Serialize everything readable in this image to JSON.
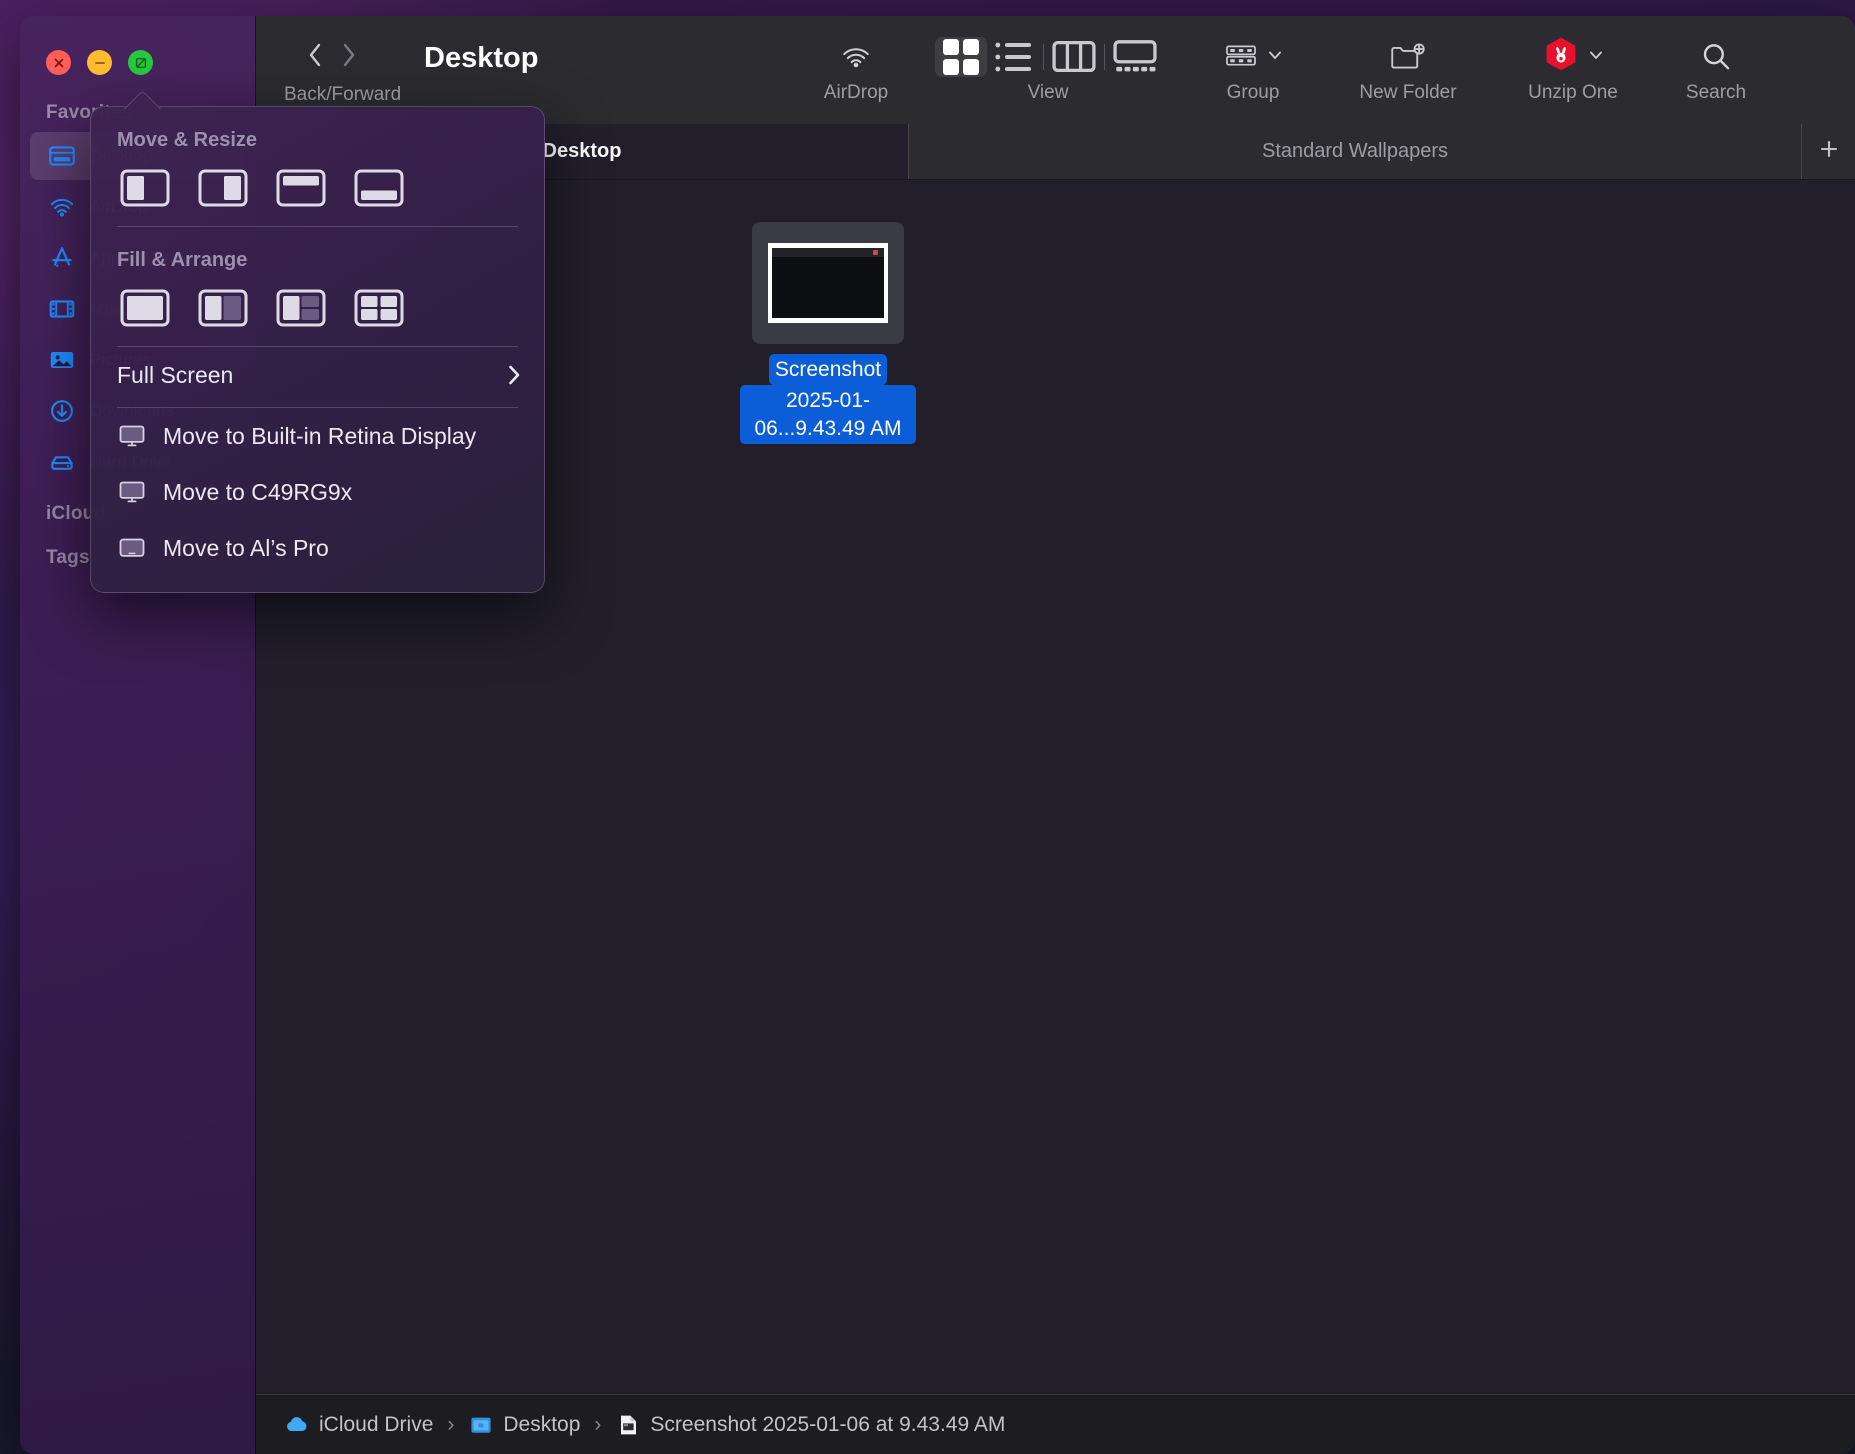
{
  "window": {
    "title": "Desktop",
    "traffic_lights": [
      {
        "name": "close",
        "color": "#ff5f57"
      },
      {
        "name": "minimize",
        "color": "#febc2e"
      },
      {
        "name": "zoom",
        "color": "#28c840"
      }
    ]
  },
  "sidebar": {
    "sections": [
      {
        "label": "Favorites"
      },
      {
        "label": "iCloud"
      },
      {
        "label": "Tags"
      }
    ],
    "favorites": [
      {
        "label": "Desktop",
        "icon": "desktop-icon",
        "selected": true
      },
      {
        "label": "AirDrop",
        "icon": "airdrop-icon",
        "selected": false
      },
      {
        "label": "Applications",
        "icon": "applications-icon",
        "selected": false
      },
      {
        "label": "Movies",
        "icon": "movies-icon",
        "selected": false
      },
      {
        "label": "Pictures",
        "icon": "pictures-icon",
        "selected": false
      },
      {
        "label": "Downloads",
        "icon": "downloads-icon",
        "selected": false
      },
      {
        "label": "Hard Drive",
        "icon": "harddrive-icon",
        "selected": false
      }
    ],
    "accent_color": "#1f8cff"
  },
  "toolbar": {
    "back_forward_label": "Back/Forward",
    "folder_title": "Desktop",
    "items": [
      {
        "key": "airdrop",
        "label": "AirDrop",
        "icon": "airdrop-icon"
      },
      {
        "key": "view",
        "label": "View",
        "icon": "view-segmented-icon"
      },
      {
        "key": "group",
        "label": "Group",
        "icon": "group-icon"
      },
      {
        "key": "new_folder",
        "label": "New Folder",
        "icon": "new-folder-icon"
      },
      {
        "key": "unzip_one",
        "label": "Unzip One",
        "icon": "unzip-one-icon"
      },
      {
        "key": "search",
        "label": "Search",
        "icon": "search-icon"
      }
    ],
    "view_modes": [
      {
        "key": "icon",
        "icon": "icon-view-icon",
        "active": true
      },
      {
        "key": "list",
        "icon": "list-view-icon",
        "active": false
      },
      {
        "key": "column",
        "icon": "column-view-icon",
        "active": false
      },
      {
        "key": "gallery",
        "icon": "gallery-view-icon",
        "active": false
      }
    ],
    "unzip_badge_color": "#e8112d"
  },
  "tabs": {
    "items": [
      {
        "label": "Desktop",
        "active": true
      },
      {
        "label": "Standard Wallpapers",
        "active": false
      }
    ],
    "add_label": "+"
  },
  "content": {
    "files": [
      {
        "name_line1": "Screenshot",
        "name_line2": "2025-01-06...9.43.49 AM",
        "selected": true,
        "selection_color": "#0b5ed7"
      }
    ]
  },
  "pathbar": {
    "crumbs": [
      {
        "label": "iCloud Drive",
        "icon": "icloud-icon"
      },
      {
        "label": "Desktop",
        "icon": "folder-icon"
      },
      {
        "label": "Screenshot 2025-01-06 at 9.43.49 AM",
        "icon": "file-icon"
      }
    ],
    "separator": "›"
  },
  "popover": {
    "sections": [
      {
        "heading": "Move & Resize",
        "tiles": [
          {
            "name": "left-half-tile"
          },
          {
            "name": "right-half-tile"
          },
          {
            "name": "top-half-tile"
          },
          {
            "name": "bottom-half-tile"
          }
        ]
      },
      {
        "heading": "Fill & Arrange",
        "tiles": [
          {
            "name": "fill-tile"
          },
          {
            "name": "arrange-left-right-tile"
          },
          {
            "name": "arrange-left-quarters-tile"
          },
          {
            "name": "arrange-quarters-tile"
          }
        ]
      }
    ],
    "full_screen": {
      "label": "Full Screen",
      "has_submenu": true
    },
    "displays": [
      {
        "label": "Move to Built-in Retina Display",
        "icon": "display-icon"
      },
      {
        "label": "Move to C49RG9x",
        "icon": "display-icon"
      },
      {
        "label": "Move to Al’s Pro",
        "icon": "tablet-icon"
      }
    ]
  }
}
